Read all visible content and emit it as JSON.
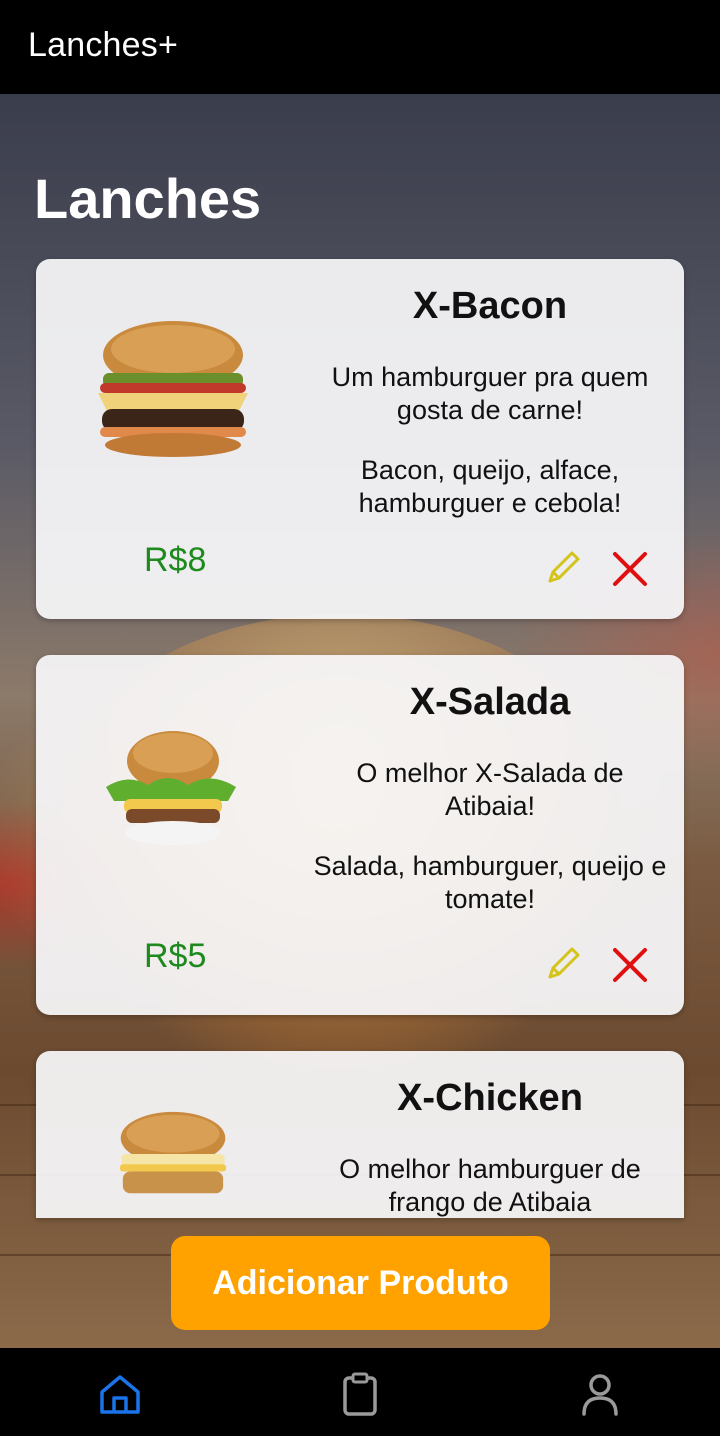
{
  "app": {
    "title": "Lanches+"
  },
  "page": {
    "heading": "Lanches"
  },
  "products": [
    {
      "name": "X-Bacon",
      "description": "Um hamburguer pra quem gosta de carne!",
      "ingredients": "Bacon, queijo, alface, hamburguer e cebola!",
      "price": "R$8"
    },
    {
      "name": "X-Salada",
      "description": "O melhor X-Salada de Atibaia!",
      "ingredients": "Salada, hamburguer, queijo e tomate!",
      "price": "R$5"
    },
    {
      "name": "X-Chicken",
      "description": "O melhor hamburguer de frango de Atibaia"
    }
  ],
  "actions": {
    "add_product_label": "Adicionar Produto"
  },
  "nav": {
    "items": [
      {
        "icon": "home-icon",
        "active": true
      },
      {
        "icon": "clipboard-icon",
        "active": false
      },
      {
        "icon": "user-icon",
        "active": false
      }
    ]
  },
  "colors": {
    "price": "#1e8a1e",
    "edit_icon": "#d4c41a",
    "delete_icon": "#e01010",
    "add_button": "#ffa200",
    "nav_active": "#1a73e8",
    "nav_inactive": "#9a9a9a"
  }
}
